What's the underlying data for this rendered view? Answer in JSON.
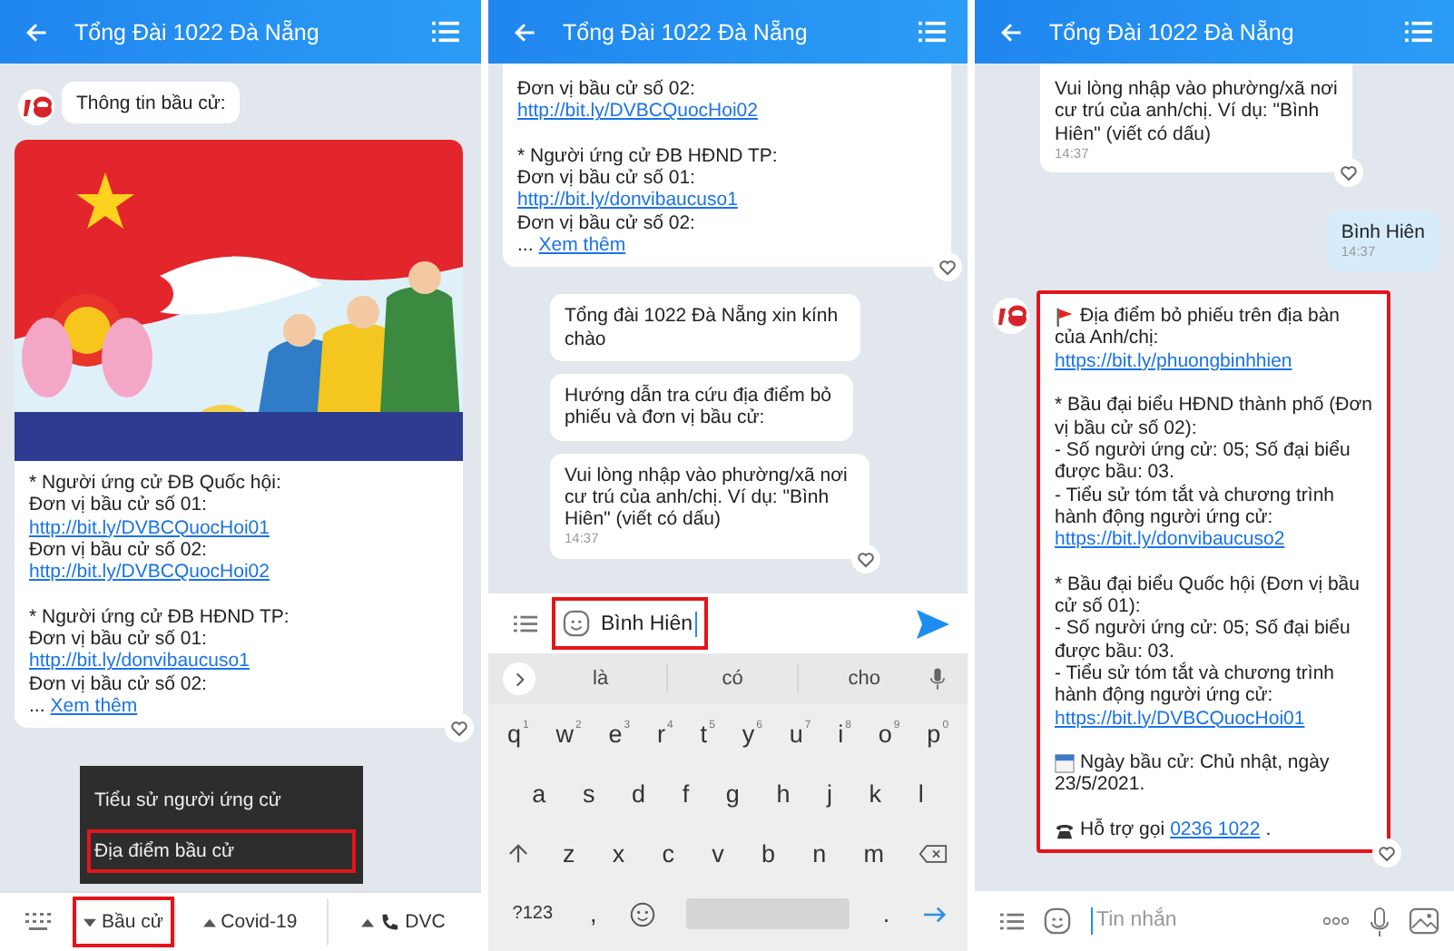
{
  "screens": [
    {
      "kind": "bot_menu",
      "header": {
        "title": "Tổng Đài 1022 Đà Nẵng"
      },
      "messages": [
        {
          "kind": "text",
          "avatar": true,
          "continued": false,
          "heart": false,
          "paragraphs": [
            [
              {
                "text": "Thông tin bầu cử:"
              }
            ]
          ]
        },
        {
          "kind": "card",
          "picture": true,
          "avatar": false,
          "continued": false,
          "heart": true,
          "paragraphs": [
            [
              {
                "text": "* Người ứng cử ĐB Quốc hội:"
              },
              {
                "text": "Đơn vị bầu cử số 01:"
              },
              {
                "link": "http://bit.ly/DVBCQuocHoi01"
              },
              {
                "text": "Đơn vị bầu cử số 02:"
              },
              {
                "link": "http://bit.ly/DVBCQuocHoi02"
              }
            ],
            [
              {
                "text": "* Người ứng cử ĐB HĐND TP:"
              },
              {
                "text": "Đơn vị bầu cử số 01:"
              },
              {
                "link": "http://bit.ly/donvibaucuso1"
              },
              {
                "text": "Đơn vị bầu cử số 02:"
              },
              {
                "text": "...",
                "link": "Xem thêm"
              }
            ]
          ]
        }
      ],
      "popup_menu": [
        {
          "label": "Tiểu sử người ứng cử",
          "highlighted": false
        },
        {
          "label": "Địa điểm bầu cử",
          "highlighted": true
        }
      ],
      "bottom_menu": [
        {
          "kind": "menu",
          "label": "Bầu cử",
          "expanded": true,
          "highlighted": true
        },
        {
          "kind": "menu",
          "label": "Covid-19",
          "expanded": false,
          "highlighted": false
        },
        {
          "kind": "call",
          "label": "DVC",
          "expanded": false,
          "highlighted": false
        }
      ]
    },
    {
      "kind": "keyboard",
      "header": {
        "title": "Tổng Đài 1022 Đà Nẵng"
      },
      "messages": [
        {
          "kind": "card",
          "picture": false,
          "avatar": false,
          "continued": true,
          "heart": true,
          "paragraphs": [
            [
              {
                "text": "Đơn vị bầu cử số 02:"
              },
              {
                "link": "http://bit.ly/DVBCQuocHoi02"
              }
            ],
            [
              {
                "text": "* Người ứng cử ĐB HĐND TP:"
              },
              {
                "text": "Đơn vị bầu cử số 01:"
              },
              {
                "link": "http://bit.ly/donvibaucuso1"
              },
              {
                "text": "Đơn vị bầu cử số 02:"
              },
              {
                "text": "...",
                "link": "Xem thêm"
              }
            ]
          ]
        },
        {
          "kind": "text",
          "avatar": false,
          "continued": false,
          "heart": false,
          "paragraphs": [
            [
              {
                "text": "Tổng đài 1022 Đà Nẵng xin kính"
              },
              {
                "text": "chào"
              }
            ]
          ]
        },
        {
          "kind": "text",
          "avatar": false,
          "continued": false,
          "heart": false,
          "paragraphs": [
            [
              {
                "text": "Hướng dẫn tra cứu địa điểm bỏ"
              },
              {
                "text": "phiếu và đơn vị bầu cử:"
              }
            ]
          ]
        },
        {
          "kind": "text",
          "avatar": false,
          "continued": false,
          "heart": true,
          "time": "14:37",
          "paragraphs": [
            [
              {
                "text": "Vui lòng nhập vào phường/xã nơi"
              },
              {
                "text": "cư trú của anh/chị. Ví dụ: \"Bình"
              },
              {
                "text": "Hiên\" (viết có dấu)"
              }
            ]
          ]
        }
      ],
      "composer": {
        "value": "Bình Hiên",
        "highlighted": true
      },
      "keyboard": {
        "suggestions": [
          "là",
          "có",
          "cho"
        ],
        "rows": [
          [
            {
              "key": "q",
              "hint": "1"
            },
            {
              "key": "w",
              "hint": "2"
            },
            {
              "key": "e",
              "hint": "3"
            },
            {
              "key": "r",
              "hint": "4"
            },
            {
              "key": "t",
              "hint": "5"
            },
            {
              "key": "y",
              "hint": "6"
            },
            {
              "key": "u",
              "hint": "7"
            },
            {
              "key": "i",
              "hint": "8"
            },
            {
              "key": "o",
              "hint": "9"
            },
            {
              "key": "p",
              "hint": "0"
            }
          ],
          [
            {
              "key": "a"
            },
            {
              "key": "s"
            },
            {
              "key": "d"
            },
            {
              "key": "f"
            },
            {
              "key": "g"
            },
            {
              "key": "h"
            },
            {
              "key": "j"
            },
            {
              "key": "k"
            },
            {
              "key": "l"
            }
          ],
          [
            {
              "key": "z"
            },
            {
              "key": "x"
            },
            {
              "key": "c"
            },
            {
              "key": "v"
            },
            {
              "key": "b"
            },
            {
              "key": "n"
            },
            {
              "key": "m"
            }
          ]
        ],
        "symbols_key": "?123",
        "comma": ",",
        "period": "."
      }
    },
    {
      "kind": "chat",
      "header": {
        "title": "Tổng Đài 1022 Đà Nẵng"
      },
      "messages": [
        {
          "kind": "text",
          "avatar": false,
          "continued": true,
          "heart": true,
          "time": "14:37",
          "paragraphs": [
            [
              {
                "text": "Vui lòng nhập vào phường/xã nơi"
              },
              {
                "text": "cư trú của anh/chị. Ví dụ: \"Bình"
              },
              {
                "text": "Hiên\" (viết có dấu)"
              }
            ]
          ]
        },
        {
          "kind": "outgoing",
          "avatar": false,
          "continued": false,
          "heart": false,
          "time": "14:37",
          "paragraphs": [
            [
              {
                "text": "Bình Hiên"
              }
            ]
          ]
        },
        {
          "kind": "text",
          "avatar": true,
          "continued": false,
          "heart": true,
          "highlighted": true,
          "paragraphs": [
            [
              {
                "kind": "flag",
                "text": "Địa điểm bỏ phiếu trên địa bàn"
              },
              {
                "text": "của Anh/chị:"
              },
              {
                "link": "https://bit.ly/phuongbinhhien"
              }
            ],
            [
              {
                "text": "* Bầu đại biểu HĐND thành phố (Đơn"
              },
              {
                "text": "vị bầu cử số 02):"
              },
              {
                "text": "- Số người ứng cử: 05; Số đại biểu"
              },
              {
                "text": "được bầu: 03."
              },
              {
                "text": "- Tiểu sử tóm tắt và chương trình"
              },
              {
                "text": "hành động người ứng cử:"
              },
              {
                "link": "https://bit.ly/donvibaucuso2"
              }
            ],
            [
              {
                "text": "* Bầu đại biểu Quốc hội (Đơn vị bầu"
              },
              {
                "text": "cử số 01):"
              },
              {
                "text": "- Số người ứng cử: 05; Số đại biểu"
              },
              {
                "text": "được bầu: 03."
              },
              {
                "text": "- Tiểu sử tóm tắt và chương trình"
              },
              {
                "text": "hành động người ứng cử:"
              },
              {
                "link": "https://bit.ly/DVBCQuocHoi01"
              }
            ],
            [
              {
                "kind": "calendar",
                "text": "Ngày bầu cử: Chủ nhật, ngày"
              },
              {
                "text": "23/5/2021."
              }
            ],
            [
              {
                "kind": "phone",
                "text": "Hỗ trợ gọi",
                "link": "0236 1022",
                "after": "."
              }
            ]
          ]
        }
      ],
      "composer": {
        "placeholder": "Tin nhắn"
      }
    }
  ]
}
